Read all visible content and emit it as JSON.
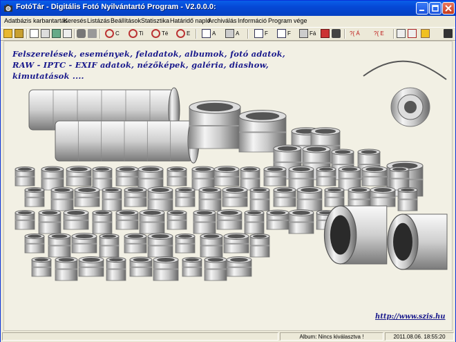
{
  "window": {
    "title": "FotóTár - Digitális Fotó Nyilvántartó Program - V2.0.0.0:"
  },
  "menu": [
    "Adatbázis karbantartás",
    "Keresés",
    "Listázás",
    "Beállítások",
    "Statisztika",
    "Határidő napló",
    "Archiválás",
    "Információ",
    "Program vége"
  ],
  "toolbar": {
    "labels": [
      "C",
      "Ti",
      "Té",
      "E",
      "A",
      "A",
      "F",
      "F",
      "Fá",
      "?{ Á",
      "?{ E"
    ]
  },
  "content": {
    "headline": "Felszerelések, események, feladatok, albumok, fotó adatok, RAW - IPTC - EXIF adatok, nézőképek, galéria, diashow, kimutatások ....",
    "link": "http://www.szis.hu"
  },
  "status": {
    "album": "Album: Nincs kiválasztva !",
    "datetime": "2011.08.06.  18:55:20"
  },
  "colors": {
    "title_bar": "#0548d6",
    "headline": "#1a1a8c",
    "background": "#f2f0e4"
  },
  "icons": [
    "app-icon",
    "minimize-icon",
    "maximize-icon",
    "close-icon"
  ]
}
